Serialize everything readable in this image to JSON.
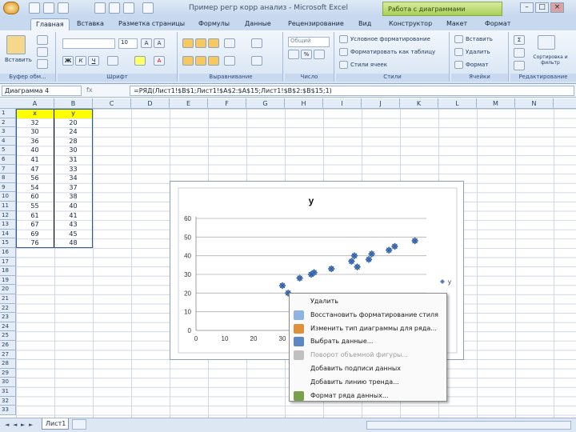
{
  "window": {
    "title": "Пример регр корр анализ - Microsoft Excel",
    "context_tab_group": "Работа с диаграммами"
  },
  "ribbon_tabs": [
    {
      "label": "Главная",
      "active": true
    },
    {
      "label": "Вставка"
    },
    {
      "label": "Разметка страницы"
    },
    {
      "label": "Формулы"
    },
    {
      "label": "Данные"
    },
    {
      "label": "Рецензирование"
    },
    {
      "label": "Вид"
    },
    {
      "label": "Конструктор"
    },
    {
      "label": "Макет"
    },
    {
      "label": "Формат"
    }
  ],
  "ribbon": {
    "paste_label": "Вставить",
    "font_size": "10",
    "number_format": "Общий",
    "groups": {
      "clipboard": "Буфер обм...",
      "font": "Шрифт",
      "alignment": "Выравнивание",
      "number": "Число",
      "styles": "Стили",
      "cells": "Ячейки",
      "editing": "Редактирование"
    },
    "styles_items": [
      "Условное форматирование",
      "Форматировать как таблицу",
      "Стили ячеек"
    ],
    "cells_items": [
      "Вставить",
      "Удалить",
      "Формат"
    ],
    "sort_label": "Сортировка и фильтр"
  },
  "formula_bar": {
    "name_box": "Диаграмма 4",
    "fx": "fx",
    "formula": "=РЯД(Лист1!$B$1;Лист1!$A$2:$A$15;Лист1!$B$2:$B$15;1)"
  },
  "columns": [
    "A",
    "B",
    "C",
    "D",
    "E",
    "F",
    "G",
    "H",
    "I",
    "J",
    "K",
    "L",
    "M",
    "N"
  ],
  "rows": [
    "1",
    "2",
    "3",
    "4",
    "5",
    "6",
    "7",
    "8",
    "9",
    "10",
    "11",
    "12",
    "13",
    "14",
    "15",
    "16",
    "17",
    "18",
    "19",
    "20",
    "21",
    "22",
    "23",
    "24",
    "25",
    "26",
    "27",
    "28",
    "29",
    "30",
    "31",
    "32",
    "33"
  ],
  "table": {
    "header": [
      "x",
      "y"
    ],
    "rows": [
      [
        "32",
        "20"
      ],
      [
        "30",
        "24"
      ],
      [
        "36",
        "28"
      ],
      [
        "40",
        "30"
      ],
      [
        "41",
        "31"
      ],
      [
        "47",
        "33"
      ],
      [
        "56",
        "34"
      ],
      [
        "54",
        "37"
      ],
      [
        "60",
        "38"
      ],
      [
        "55",
        "40"
      ],
      [
        "61",
        "41"
      ],
      [
        "67",
        "43"
      ],
      [
        "69",
        "45"
      ],
      [
        "76",
        "48"
      ]
    ]
  },
  "colors": {
    "header_fill": "#ffff00",
    "series": "#4f81bd",
    "accent": "#c7d9ef"
  },
  "chart_data": {
    "type": "scatter",
    "title": "y",
    "series": [
      {
        "name": "y",
        "x": [
          32,
          30,
          36,
          40,
          41,
          47,
          56,
          54,
          60,
          55,
          61,
          67,
          69,
          76
        ],
        "y": [
          20,
          24,
          28,
          30,
          31,
          33,
          34,
          37,
          38,
          40,
          41,
          43,
          45,
          48
        ]
      }
    ],
    "x_ticks": [
      "0",
      "10",
      "20",
      "30"
    ],
    "y_ticks": [
      "0",
      "10",
      "20",
      "30",
      "40",
      "50",
      "60"
    ],
    "xlim": [
      0,
      80
    ],
    "ylim": [
      0,
      60
    ],
    "legend_position": "right",
    "grid": true,
    "selected": true
  },
  "context_menu": {
    "items": [
      {
        "label": "Удалить",
        "enabled": true,
        "icon": "none"
      },
      {
        "label": "Восстановить форматирование стиля",
        "enabled": true,
        "icon": "format-reset-icon"
      },
      {
        "label": "Изменить тип диаграммы для ряда...",
        "enabled": true,
        "icon": "chart-type-icon"
      },
      {
        "label": "Выбрать данные...",
        "enabled": true,
        "icon": "select-data-icon"
      },
      {
        "label": "Поворот объемной фигуры...",
        "enabled": false,
        "icon": "rotate-3d-icon"
      },
      {
        "label": "Добавить подписи данных",
        "enabled": true,
        "icon": "none"
      },
      {
        "label": "Добавить линию тренда...",
        "enabled": true,
        "icon": "none"
      },
      {
        "label": "Формат ряда данных...",
        "enabled": true,
        "icon": "format-series-icon"
      }
    ]
  },
  "sheet_tabs": [
    "Лист1"
  ]
}
